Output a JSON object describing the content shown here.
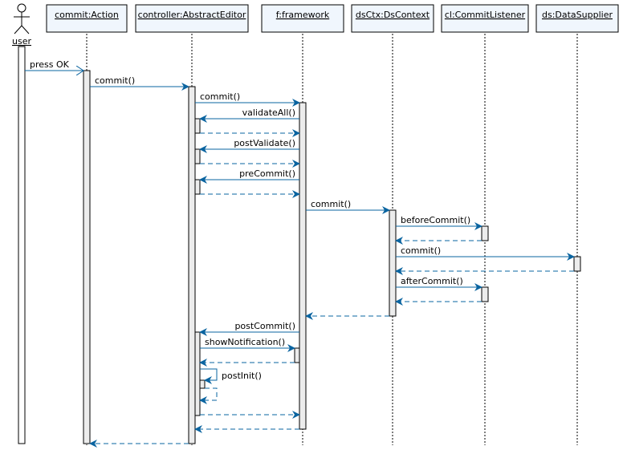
{
  "diagram": {
    "type": "sequence",
    "colors": {
      "message": "#0a64a0",
      "header_fill": "#f0f6fd",
      "activation_fill": "#ececec",
      "border": "#000000"
    },
    "actor": {
      "id": "user",
      "label": "user"
    },
    "participants": [
      {
        "id": "action",
        "label": "commit:Action"
      },
      {
        "id": "controller",
        "label": "controller:AbstractEditor"
      },
      {
        "id": "framework",
        "label": "f:framework"
      },
      {
        "id": "dsctx",
        "label": "dsCtx:DsContext"
      },
      {
        "id": "cl",
        "label": "cl:CommitListener"
      },
      {
        "id": "ds",
        "label": "ds:DataSupplier"
      }
    ],
    "messages": [
      {
        "from": "user",
        "to": "action",
        "label": "press OK",
        "kind": "async"
      },
      {
        "from": "action",
        "to": "controller",
        "label": "commit()",
        "kind": "call"
      },
      {
        "from": "controller",
        "to": "framework",
        "label": "commit()",
        "kind": "call"
      },
      {
        "from": "framework",
        "to": "controller",
        "label": "validateAll()",
        "kind": "call"
      },
      {
        "from": "controller",
        "to": "framework",
        "label": "",
        "kind": "return"
      },
      {
        "from": "framework",
        "to": "controller",
        "label": "postValidate()",
        "kind": "call"
      },
      {
        "from": "controller",
        "to": "framework",
        "label": "",
        "kind": "return"
      },
      {
        "from": "framework",
        "to": "controller",
        "label": "preCommit()",
        "kind": "call"
      },
      {
        "from": "controller",
        "to": "framework",
        "label": "",
        "kind": "return"
      },
      {
        "from": "framework",
        "to": "dsctx",
        "label": "commit()",
        "kind": "call"
      },
      {
        "from": "dsctx",
        "to": "cl",
        "label": "beforeCommit()",
        "kind": "call"
      },
      {
        "from": "cl",
        "to": "dsctx",
        "label": "",
        "kind": "return"
      },
      {
        "from": "dsctx",
        "to": "ds",
        "label": "commit()",
        "kind": "call"
      },
      {
        "from": "ds",
        "to": "dsctx",
        "label": "",
        "kind": "return"
      },
      {
        "from": "dsctx",
        "to": "cl",
        "label": "afterCommit()",
        "kind": "call"
      },
      {
        "from": "cl",
        "to": "dsctx",
        "label": "",
        "kind": "return"
      },
      {
        "from": "dsctx",
        "to": "framework",
        "label": "",
        "kind": "return"
      },
      {
        "from": "framework",
        "to": "controller",
        "label": "postCommit()",
        "kind": "call"
      },
      {
        "from": "controller",
        "to": "framework",
        "label": "showNotification()",
        "kind": "call"
      },
      {
        "from": "framework",
        "to": "controller",
        "label": "",
        "kind": "return"
      },
      {
        "from": "controller",
        "to": "controller",
        "label": "postInit()",
        "kind": "self-call"
      },
      {
        "from": "controller",
        "to": "controller",
        "label": "",
        "kind": "self-return"
      },
      {
        "from": "controller",
        "to": "framework",
        "label": "",
        "kind": "return"
      },
      {
        "from": "framework",
        "to": "controller",
        "label": "",
        "kind": "return"
      },
      {
        "from": "controller",
        "to": "action",
        "label": "",
        "kind": "return"
      }
    ]
  }
}
